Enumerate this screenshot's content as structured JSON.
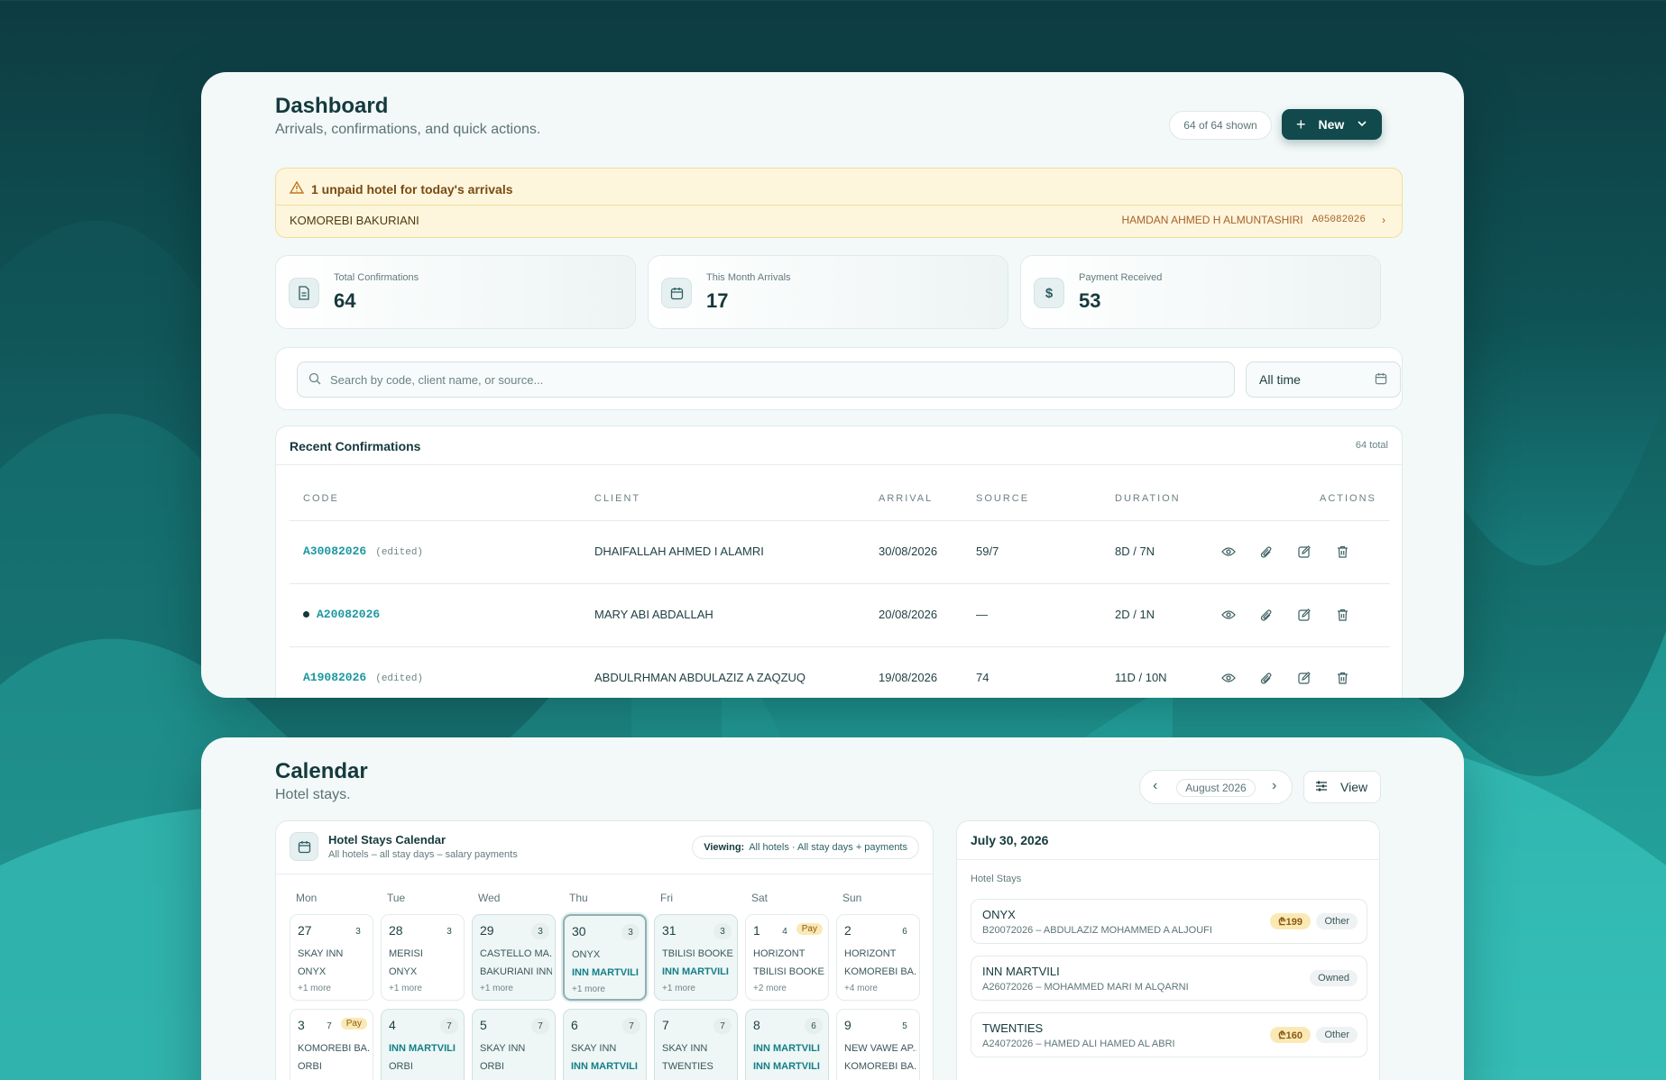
{
  "dashboard": {
    "title": "Dashboard",
    "subtitle": "Arrivals, confirmations, and quick actions.",
    "shown": "64 of 64 shown",
    "new_label": "New",
    "alert": {
      "title": "1 unpaid hotel for today's arrivals",
      "hotel": "KOMOREBI BAKURIANI",
      "client": "HAMDAN AHMED H ALMUNTASHIRI",
      "code": "A05082026"
    },
    "stats": [
      {
        "label": "Total Confirmations",
        "value": "64",
        "icon": "document-icon"
      },
      {
        "label": "This Month Arrivals",
        "value": "17",
        "icon": "calendar-icon"
      },
      {
        "label": "Payment Received",
        "value": "53",
        "icon": "dollar-icon"
      }
    ],
    "search_placeholder": "Search by code, client name, or source...",
    "date_filter": "All time",
    "recent": {
      "title": "Recent Confirmations",
      "total": "64 total",
      "columns": [
        "CODE",
        "CLIENT",
        "ARRIVAL",
        "SOURCE",
        "DURATION",
        "ACTIONS"
      ],
      "rows": [
        {
          "code": "A30082026",
          "edited": "(edited)",
          "client": "DHAIFALLAH AHMED I ALAMRI",
          "arrival": "30/08/2026",
          "source": "59/7",
          "duration": "8D / 7N",
          "dot": false
        },
        {
          "code": "A20082026",
          "edited": "",
          "client": "MARY ABI ABDALLAH",
          "arrival": "20/08/2026",
          "source": "—",
          "duration": "2D / 1N",
          "dot": true
        },
        {
          "code": "A19082026",
          "edited": "(edited)",
          "client": "ABDULRHMAN ABDULAZIZ A ZAQZUQ",
          "arrival": "19/08/2026",
          "source": "74",
          "duration": "11D / 10N",
          "dot": false
        }
      ]
    }
  },
  "calendar": {
    "title": "Calendar",
    "subtitle": "Hotel stays.",
    "month": "August 2026",
    "view_label": "View",
    "panel_title": "Hotel Stays Calendar",
    "panel_sub": "All hotels – all stay days – salary payments",
    "viewing_label": "Viewing:",
    "viewing_value": "All hotels · All stay days + payments",
    "weekdays": [
      "Mon",
      "Tue",
      "Wed",
      "Thu",
      "Fri",
      "Sat",
      "Sun"
    ],
    "week1": [
      {
        "num": "27",
        "count": "3",
        "pay": "",
        "lines": [
          "SKAY INN",
          "ONYX"
        ],
        "hl": [
          false,
          false
        ],
        "more": "+1 more",
        "range": false,
        "sel": false
      },
      {
        "num": "28",
        "count": "3",
        "pay": "",
        "lines": [
          "MERISI",
          "ONYX"
        ],
        "hl": [
          false,
          false
        ],
        "more": "+1 more",
        "range": false,
        "sel": false
      },
      {
        "num": "29",
        "count": "3",
        "pay": "",
        "lines": [
          "CASTELLO MA...",
          "BAKURIANI INN"
        ],
        "hl": [
          false,
          false
        ],
        "more": "+1 more",
        "range": true,
        "sel": false
      },
      {
        "num": "30",
        "count": "3",
        "pay": "",
        "lines": [
          "ONYX",
          "INN MARTVILI"
        ],
        "hl": [
          false,
          true
        ],
        "more": "+1 more",
        "range": true,
        "sel": true
      },
      {
        "num": "31",
        "count": "3",
        "pay": "",
        "lines": [
          "TBILISI BOOKE...",
          "INN MARTVILI"
        ],
        "hl": [
          false,
          true
        ],
        "more": "+1 more",
        "range": true,
        "sel": false
      },
      {
        "num": "1",
        "count": "4",
        "pay": "Pay",
        "lines": [
          "HORIZONT",
          "TBILISI BOOKE..."
        ],
        "hl": [
          false,
          false
        ],
        "more": "+2 more",
        "range": false,
        "sel": false
      },
      {
        "num": "2",
        "count": "6",
        "pay": "",
        "lines": [
          "HORIZONT",
          "KOMOREBI BA..."
        ],
        "hl": [
          false,
          false
        ],
        "more": "+4 more",
        "range": false,
        "sel": false
      }
    ],
    "week2": [
      {
        "num": "3",
        "count": "7",
        "pay": "Pay",
        "lines": [
          "KOMOREBI BA...",
          "ORBI"
        ],
        "hl": [
          false,
          false
        ],
        "range": false
      },
      {
        "num": "4",
        "count": "7",
        "pay": "",
        "lines": [
          "INN MARTVILI",
          "ORBI"
        ],
        "hl": [
          true,
          false
        ],
        "range": true
      },
      {
        "num": "5",
        "count": "7",
        "pay": "",
        "lines": [
          "SKAY INN",
          "ORBI"
        ],
        "hl": [
          false,
          false
        ],
        "range": true
      },
      {
        "num": "6",
        "count": "7",
        "pay": "",
        "lines": [
          "SKAY INN",
          "INN MARTVILI"
        ],
        "hl": [
          false,
          true
        ],
        "range": true
      },
      {
        "num": "7",
        "count": "7",
        "pay": "",
        "lines": [
          "SKAY INN",
          "TWENTIES"
        ],
        "hl": [
          false,
          false
        ],
        "range": true
      },
      {
        "num": "8",
        "count": "6",
        "pay": "",
        "lines": [
          "INN MARTVILI",
          "INN MARTVILI"
        ],
        "hl": [
          true,
          true
        ],
        "range": true
      },
      {
        "num": "9",
        "count": "5",
        "pay": "",
        "lines": [
          "NEW VAWE AP...",
          "KOMOREBI BA..."
        ],
        "hl": [
          false,
          false
        ],
        "range": false
      }
    ],
    "side": {
      "date": "July 30, 2026",
      "label": "Hotel Stays",
      "stays": [
        {
          "name": "ONYX",
          "detail": "B20072026 – ABDULAZIZ MOHAMMED A ALJOUFI",
          "amount": "₾199",
          "tag": "Other"
        },
        {
          "name": "INN MARTVILI",
          "detail": "A26072026 – MOHAMMED MARI M ALQARNI",
          "amount": "",
          "tag": "Owned"
        },
        {
          "name": "TWENTIES",
          "detail": "A24072026 – HAMED ALI HAMED AL ABRI",
          "amount": "₾160",
          "tag": "Other"
        }
      ]
    }
  },
  "colors": {
    "accent": "#11494d",
    "link": "#1c97a0",
    "warning_bg": "#fdf6dc",
    "pay_bg": "#fbe9b5"
  }
}
